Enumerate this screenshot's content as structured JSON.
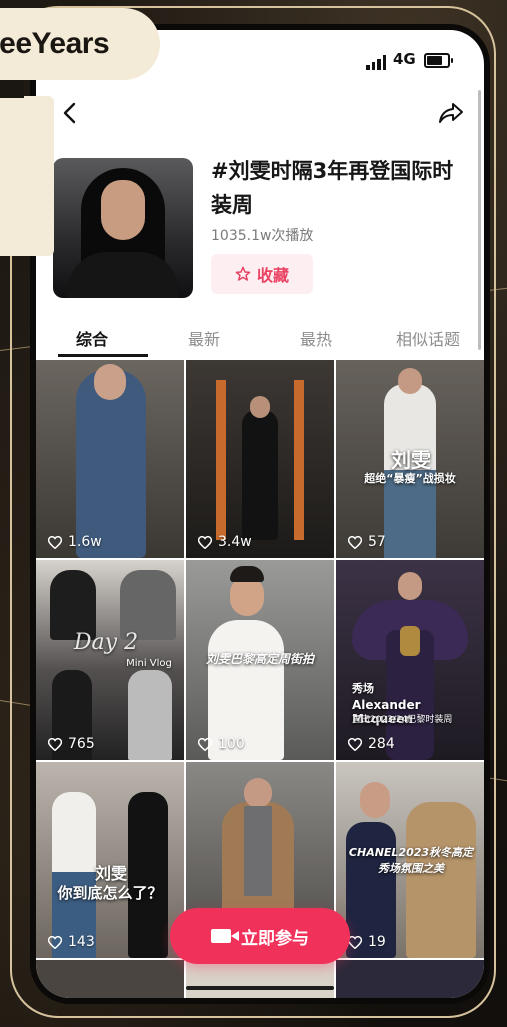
{
  "brand": {
    "text": "reeYears"
  },
  "status_bar": {
    "network": "4G"
  },
  "topic": {
    "title": "#刘雯时隔3年再登国际时装周",
    "plays": "1035.1w次播放",
    "collect_label": "收藏"
  },
  "tabs": [
    "综合",
    "最新",
    "最热",
    "相似话题"
  ],
  "active_tab": 0,
  "videos": [
    {
      "likes": "1.6w"
    },
    {
      "likes": "3.4w"
    },
    {
      "likes": "57",
      "overlay_title": "刘雯",
      "overlay_sub": "超绝“暴瘦”战损妆"
    },
    {
      "likes": "765",
      "overlay_title": "Day 2",
      "overlay_sub": "Mini Vlog"
    },
    {
      "likes": "100",
      "overlay_title": "刘雯巴黎高定周街拍"
    },
    {
      "likes": "284",
      "overlay_tag": "秀场",
      "overlay_title": "Alexander Mcqueen",
      "overlay_sub": "直击2023/24巴黎时装周"
    },
    {
      "likes": "143",
      "overlay_title": "刘雯",
      "overlay_sub": "你到底怎么了？"
    },
    {
      "likes": ""
    },
    {
      "likes": "19",
      "overlay_title": "CHANEL2023秋冬高定",
      "overlay_sub": "秀场氛围之美"
    }
  ],
  "join_button": {
    "label": "立即参与"
  },
  "icons": {
    "back": "back-arrow-icon",
    "share": "share-icon",
    "collect": "star-icon",
    "likes": "heart-icon",
    "join": "camera-icon"
  },
  "colors": {
    "accent": "#f0325a",
    "collect_bg": "#fdeef1",
    "gold_frame": "#d6c29c",
    "pill_bg": "#f3ead7"
  }
}
